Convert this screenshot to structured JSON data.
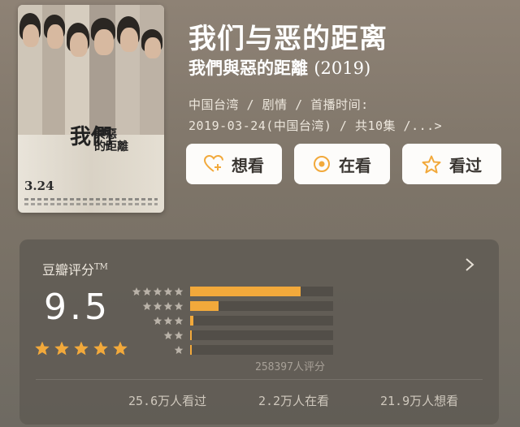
{
  "poster": {
    "title_line1": "我們",
    "title_line2": "與惡",
    "title_line3": "的距離",
    "date": "3.24"
  },
  "title": "我们与恶的距离",
  "original_title": "我們與惡的距離",
  "year": "(2019)",
  "meta_line1": "中国台湾 / 剧情 / 首播时间:",
  "meta_line2": "2019-03-24(中国台湾) / 共10集 /...>",
  "actions": {
    "want": "想看",
    "watching": "在看",
    "watched": "看过"
  },
  "rating": {
    "label": "豆瓣评分",
    "tm": "TM",
    "score": "9.5",
    "stars": 5,
    "distribution": [
      {
        "stars": 5,
        "fraction": 0.77
      },
      {
        "stars": 4,
        "fraction": 0.2
      },
      {
        "stars": 3,
        "fraction": 0.02
      },
      {
        "stars": 2,
        "fraction": 0.005
      },
      {
        "stars": 1,
        "fraction": 0.005
      }
    ],
    "count": "258397人评分"
  },
  "stats": {
    "watched": "25.6万人看过",
    "watching": "2.2万人在看",
    "want": "21.9万人想看"
  },
  "colors": {
    "accent": "#f2a93b",
    "button_bg": "#fdfcfa",
    "card_bg": "#5f5a54"
  }
}
